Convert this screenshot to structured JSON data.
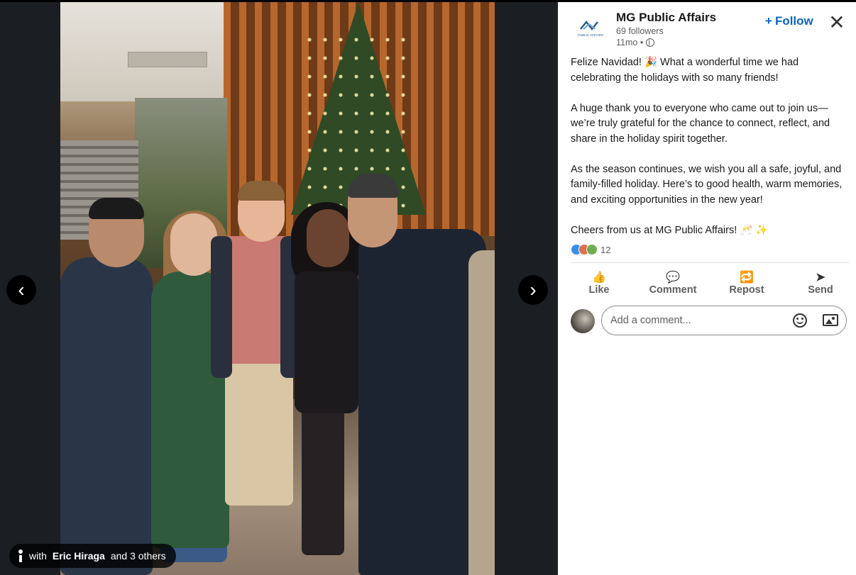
{
  "photo": {
    "tag": {
      "prefix": "with",
      "name": "Eric Hiraga",
      "suffix": "and 3 others"
    },
    "nav": {
      "prev": "‹",
      "next": "›"
    }
  },
  "post": {
    "author": {
      "name": "MG Public Affairs",
      "followers": "69 followers",
      "time": "11mo •",
      "logo_text": "PUBLIC AFFAIRS"
    },
    "follow_label": "Follow",
    "follow_icon": "+",
    "close_icon": "✕",
    "paragraphs": [
      "Felize Navidad! 🎉 What a wonderful time we had celebrating the holidays with so many friends!",
      "A huge thank you to everyone who came out to join us—we’re truly grateful for the chance to connect, reflect, and share in the holiday spirit together.",
      "As the season continues, we wish you all a safe, joyful, and family-filled holiday. Here’s to good health, warm memories, and exciting opportunities in the new year!",
      "Cheers from us at MG Public Affairs! 🥂 ✨"
    ],
    "reaction_count": "12",
    "reaction_icons": [
      "like-reaction-icon",
      "love-reaction-icon",
      "support-reaction-icon"
    ],
    "colors": {
      "accent": "#0a66c2",
      "like": "#378fe9",
      "love": "#df704d",
      "support": "#6dae4f"
    }
  },
  "actions": [
    {
      "label": "Like",
      "icon": "👍"
    },
    {
      "label": "Comment",
      "icon": "💬"
    },
    {
      "label": "Repost",
      "icon": "🔁"
    },
    {
      "label": "Send",
      "icon": "➤"
    }
  ],
  "comment": {
    "placeholder": "Add a comment..."
  }
}
